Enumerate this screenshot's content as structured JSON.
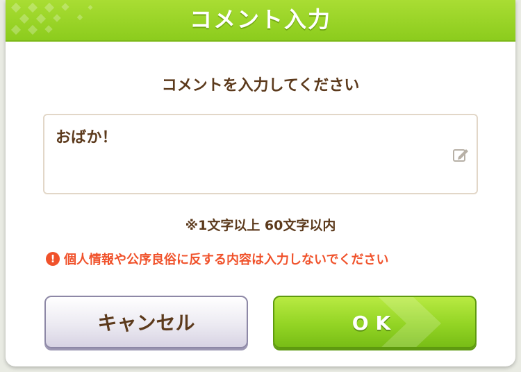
{
  "dialog": {
    "title": "コメント入力",
    "prompt": "コメントを入力してください",
    "comment": {
      "value": "おばか！",
      "icon": "edit-icon"
    },
    "limit_note": "※1文字以上 60文字以内",
    "warning": {
      "icon": "!",
      "text": "個人情報や公序良俗に反する内容は入力しないでください"
    },
    "buttons": {
      "cancel_label": "キャンセル",
      "ok_label": "OK"
    }
  },
  "colors": {
    "header_green": "#8ccc1d",
    "text_brown": "#5c3a1c",
    "warning_orange": "#f0522b"
  }
}
